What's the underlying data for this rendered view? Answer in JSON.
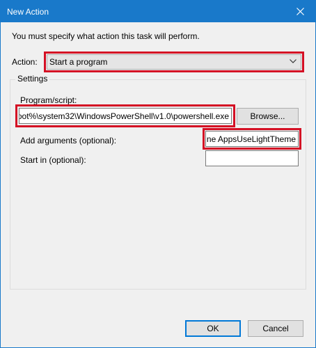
{
  "window": {
    "title": "New Action"
  },
  "instruction": "You must specify what action this task will perform.",
  "action": {
    "label": "Action:",
    "selected": "Start a program"
  },
  "settings": {
    "title": "Settings",
    "program_label": "Program/script:",
    "program_value": "oot%\\system32\\WindowsPowerShell\\v1.0\\powershell.exe",
    "browse_label": "Browse...",
    "args_label": "Add arguments (optional):",
    "args_value": "ne AppsUseLightTheme",
    "start_label": "Start in (optional):",
    "start_value": ""
  },
  "buttons": {
    "ok": "OK",
    "cancel": "Cancel"
  },
  "colors": {
    "titlebar": "#1979ca",
    "highlight": "#d40f24",
    "default_button": "#0078d7"
  },
  "icons": {
    "close": "close-icon",
    "dropdown": "chevron-down-icon"
  }
}
